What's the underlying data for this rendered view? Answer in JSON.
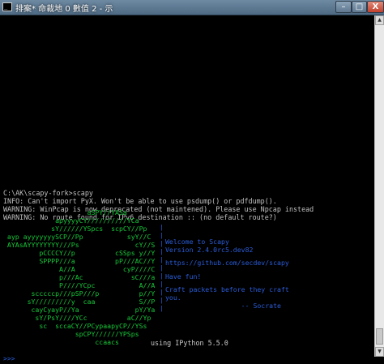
{
  "window": {
    "title": "排案* 命裁地 0 數值 2 - 示",
    "min_label": "–",
    "max_label": "□",
    "close_label": "X"
  },
  "console": {
    "prompt_line": "C:\\AK\\scapy-fork>scapy",
    "messages": [
      "INFO: Can't import PyX. Won't be able to use psdump() or pdfdump().",
      "WARNING: WinPcap is now deprecated (not maintened). Please use Npcap instead",
      "WARNING: No route found for IPv6 destination :: (no default route?)"
    ],
    "banner_art": [
      "                     aSPY//YASa",
      "             apyyyyCY//////////YCa",
      "            sY//////YSpcs  scpCY//Pp",
      " ayp ayyyyyyySCP//Pp           syY//C",
      " AYAsAYYYYYYYY///Ps              cY//S",
      "         pCCCCY//p          cSSps y//Y",
      "         SPPPP///a          pP///AC//Y",
      "              A//A            cyP////C",
      "              p///Ac            sC///a",
      "              P////YCpc           A//A",
      "       scccccp///pSP///p          p//Y",
      "      sY/////////y  caa           S//P",
      "       cayCyayP//Ya              pY/Ya",
      "        sY/PsY////YCc          aC//Yp",
      "         sc  sccaCY//PCypaapyCP//YSs",
      "                  spCPY//////YPSps",
      "                       ccaacs"
    ],
    "info_lines": [
      "Welcome to Scapy",
      "Version 2.4.0rc5.dev82",
      "",
      "https://github.com/secdev/scapy",
      "",
      "Have fun!",
      "",
      "Craft packets before they craft",
      "you.",
      "                   -- Socrate"
    ],
    "ipython_line": "using IPython 5.5.0",
    "input_prompt": ">>>"
  },
  "colors": {
    "background": "#000000",
    "text": "#c0c0c0",
    "art": "#18c83a",
    "info": "#2a5cd8"
  },
  "icons": {
    "window": "cmd-icon",
    "scroll_up": "arrow-up-icon",
    "scroll_down": "arrow-down-icon"
  }
}
